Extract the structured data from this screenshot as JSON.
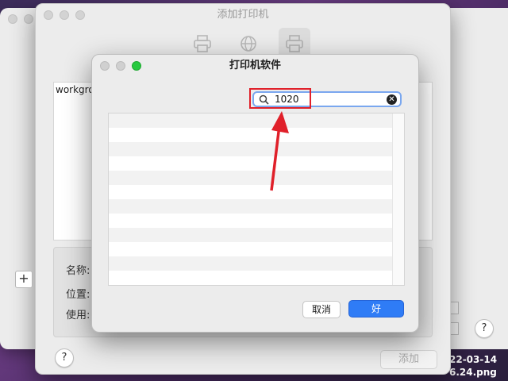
{
  "back_window": {
    "help": "?",
    "date_label": "22-03-14",
    "file_label": "6.24.png"
  },
  "add_printer": {
    "title": "添加打印机",
    "printer_item": "workgrou",
    "labels": {
      "name": "名称:",
      "location": "位置:",
      "use": "使用:"
    },
    "plus": "+",
    "help": "?",
    "add_button": "添加",
    "toolbar_icons": [
      "printer-default-icon",
      "globe-icon",
      "printer-ip-icon"
    ]
  },
  "dialog": {
    "title": "打印机软件",
    "search": {
      "value": "1020",
      "icon": "search-icon",
      "clear": "✕"
    },
    "cancel": "取消",
    "ok": "好"
  },
  "annotation": {
    "highlight_color": "#e0202a"
  }
}
